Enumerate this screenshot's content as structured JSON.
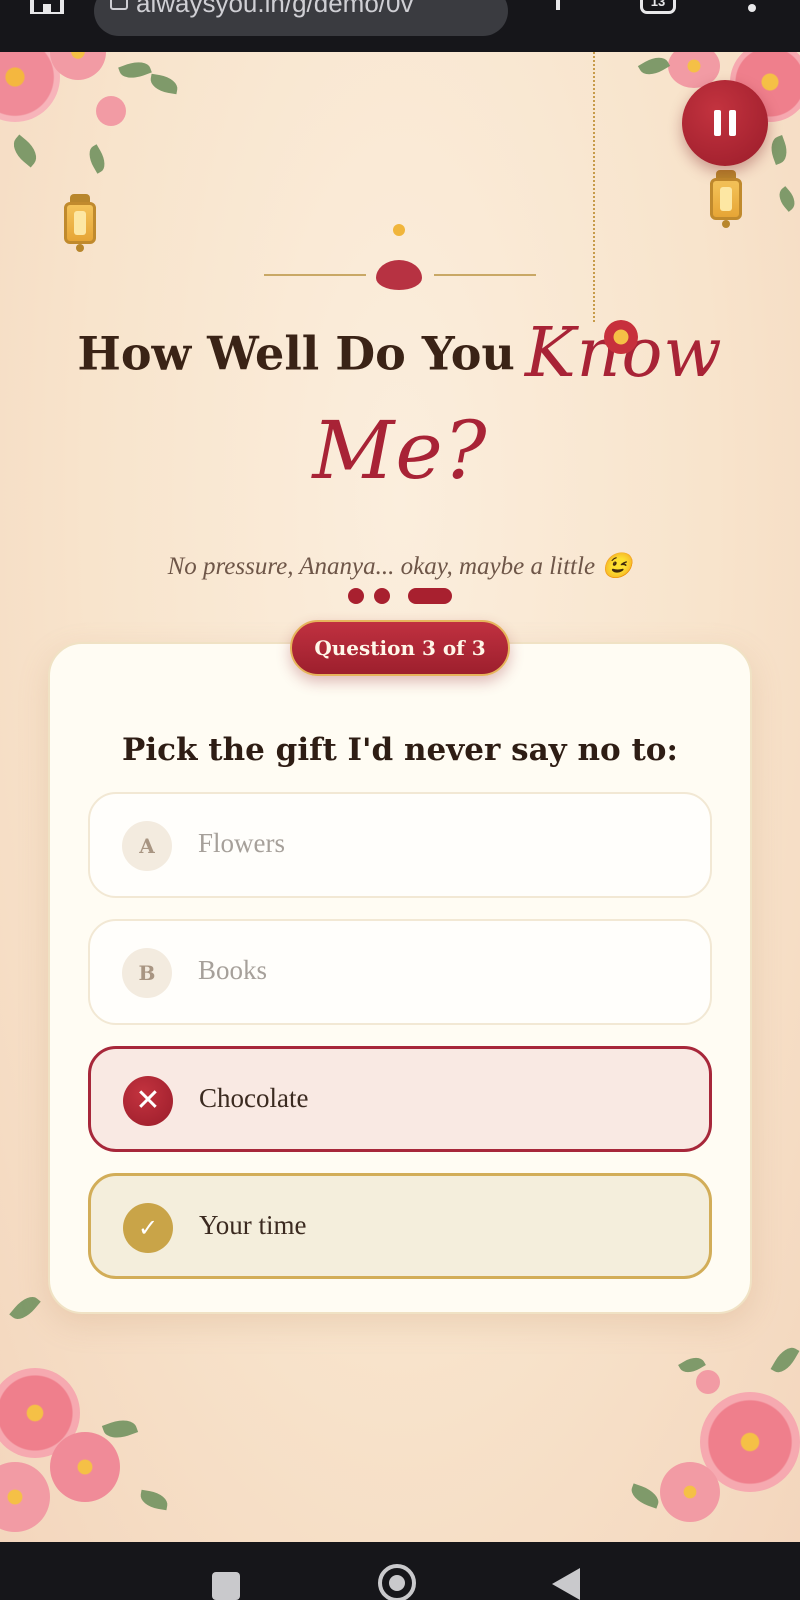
{
  "browser": {
    "url": "alwaysyou.in/g/demo/0v",
    "tab_count": "13"
  },
  "page": {
    "title_plain": "How Well Do You",
    "title_script_1": "Know",
    "title_script_2": "Me?",
    "subtitle": "No pressure, Ananya... okay, maybe a little 😉",
    "progress": {
      "current": 3,
      "total": 3
    }
  },
  "quiz": {
    "badge": "Question 3 of 3",
    "question": "Pick the gift I'd never say no to:",
    "options": [
      {
        "marker": "A",
        "label": "Flowers",
        "state": "disabled"
      },
      {
        "marker": "B",
        "label": "Books",
        "state": "disabled"
      },
      {
        "marker": "✕",
        "label": "Chocolate",
        "state": "wrong"
      },
      {
        "marker": "✓",
        "label": "Your time",
        "state": "correct"
      }
    ]
  },
  "colors": {
    "accent": "#a8202f",
    "gold": "#c9a448",
    "background": "#f8e4cc"
  },
  "icons": {
    "pause": "pause-icon",
    "home": "home-icon",
    "tabs": "tabs-icon",
    "menu": "menu-icon"
  }
}
